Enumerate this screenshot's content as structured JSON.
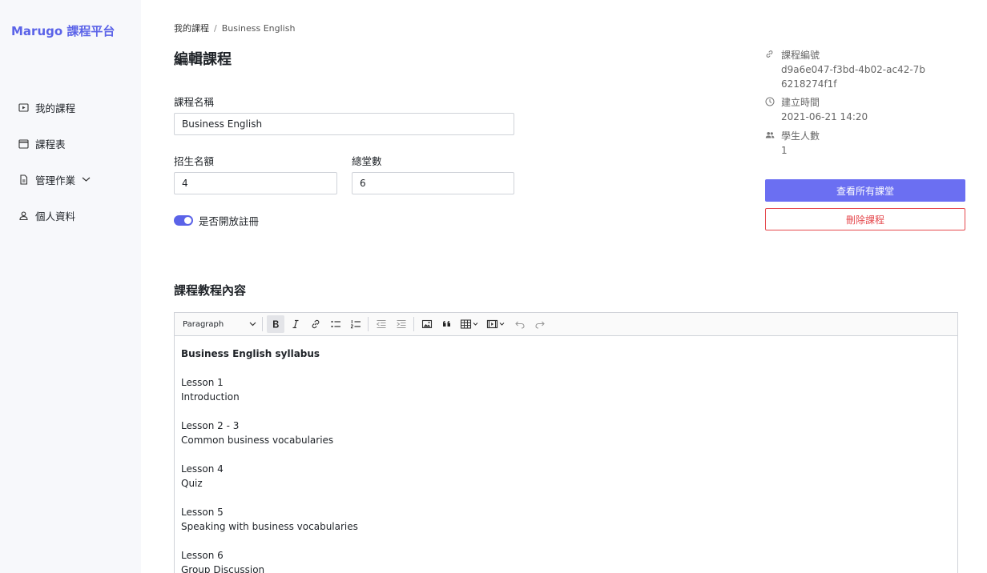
{
  "brand": "Marugo 課程平台",
  "sidebar": {
    "items": [
      {
        "label": "我的課程",
        "icon": "play-square-icon"
      },
      {
        "label": "課程表",
        "icon": "calendar-icon"
      },
      {
        "label": "管理作業",
        "icon": "document-icon",
        "has_submenu": true
      },
      {
        "label": "個人資料",
        "icon": "user-icon"
      }
    ]
  },
  "breadcrumb": {
    "parent": "我的課程",
    "separator": "/",
    "current": "Business English"
  },
  "page_title": "編輯課程",
  "form": {
    "name_label": "課程名稱",
    "name_value": "Business English",
    "quota_label": "招生名額",
    "quota_value": "4",
    "sessions_label": "總堂數",
    "sessions_value": "6",
    "registration_label": "是否開放註冊",
    "registration_enabled": true
  },
  "content_section": {
    "title": "課程教程內容",
    "format_select": "Paragraph",
    "body": [
      {
        "text": "Business English syllabus",
        "bold": true
      },
      {
        "text": ""
      },
      {
        "text": "Lesson 1"
      },
      {
        "text": "Introduction"
      },
      {
        "text": ""
      },
      {
        "text": "Lesson 2 - 3"
      },
      {
        "text": "Common business vocabularies"
      },
      {
        "text": ""
      },
      {
        "text": "Lesson 4"
      },
      {
        "text": "Quiz"
      },
      {
        "text": ""
      },
      {
        "text": "Lesson 5"
      },
      {
        "text": "Speaking with business vocabularies"
      },
      {
        "text": ""
      },
      {
        "text": "Lesson 6"
      },
      {
        "text": "Group Discussion"
      }
    ]
  },
  "meta": {
    "id_label": "課程編號",
    "id_value": "d9a6e047-f3bd-4b02-ac42-7b6218274f1f",
    "created_label": "建立時間",
    "created_value": "2021-06-21 14:20",
    "students_label": "學生人數",
    "students_value": "1"
  },
  "actions": {
    "view_all_label": "查看所有課堂",
    "delete_label": "刪除課程"
  },
  "colors": {
    "accent": "#5b63e8",
    "primary_button": "#6b6ff2",
    "danger": "#e5484d",
    "sidebar_bg": "#f7f8fb"
  }
}
